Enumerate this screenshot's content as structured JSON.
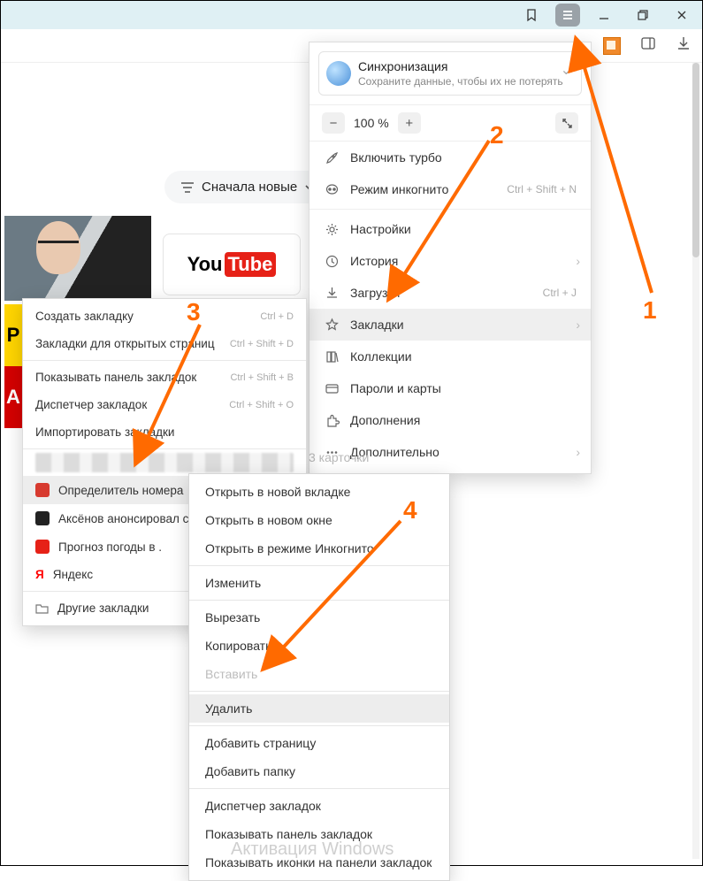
{
  "titlebar": {
    "bookmark_icon": "bookmark",
    "menu_icon": "menu"
  },
  "toolbar": {
    "ext_icon": "extension",
    "sidebar_icon": "sidebar",
    "download_icon": "download"
  },
  "sort_pill": {
    "label": "Сначала новые"
  },
  "sync": {
    "title": "Синхронизация",
    "subtitle": "Сохраните данные, чтобы их не потерять"
  },
  "zoom": {
    "minus": "−",
    "value": "100 %",
    "plus": "+"
  },
  "main_menu": [
    {
      "icon": "rocket",
      "label": "Включить турбо",
      "shortcut": "",
      "arrow": false,
      "highlight": false
    },
    {
      "icon": "mask",
      "label": "Режим инкогнито",
      "shortcut": "Ctrl + Shift + N",
      "arrow": false,
      "highlight": false
    },
    {
      "sep": true
    },
    {
      "icon": "gear",
      "label": "Настройки",
      "shortcut": "",
      "arrow": false
    },
    {
      "icon": "clock",
      "label": "История",
      "shortcut": "",
      "arrow": true
    },
    {
      "icon": "download",
      "label": "Загрузки",
      "shortcut": "Ctrl + J",
      "arrow": false
    },
    {
      "icon": "star",
      "label": "Закладки",
      "shortcut": "",
      "arrow": true,
      "highlight": true
    },
    {
      "icon": "collection",
      "label": "Коллекции",
      "shortcut": "",
      "arrow": false
    },
    {
      "icon": "card",
      "label": "Пароли и карты",
      "shortcut": "",
      "arrow": false
    },
    {
      "icon": "puzzle",
      "label": "Дополнения",
      "shortcut": "",
      "arrow": false
    },
    {
      "icon": "dots",
      "label": "Дополнительно",
      "shortcut": "",
      "arrow": true
    }
  ],
  "cards_label": "3 карточки",
  "bookmarks_menu": {
    "top": [
      {
        "label": "Создать закладку",
        "shortcut": "Ctrl + D"
      },
      {
        "label": "Закладки для открытых страниц",
        "shortcut": "Ctrl + Shift + D"
      }
    ],
    "mid": [
      {
        "label": "Показывать панель закладок",
        "shortcut": "Ctrl + Shift + B"
      },
      {
        "label": "Диспетчер закладок",
        "shortcut": "Ctrl + Shift + O"
      },
      {
        "label": "Импортировать закладки"
      }
    ],
    "items": [
      {
        "icon_color": "#d73a2f",
        "label": "Определитель номера",
        "hover": true
      },
      {
        "icon_color": "#222",
        "label": "Аксёнов анонсировал с"
      },
      {
        "icon_color": "#e62117",
        "label": "Прогноз погоды в ."
      },
      {
        "icon_color": "#ff0000",
        "label": "Яндекс",
        "icon_text": "Я"
      }
    ],
    "other": {
      "label": "Другие закладки"
    }
  },
  "context_menu": [
    {
      "label": "Открыть в новой вкладке"
    },
    {
      "label": "Открыть в новом окне"
    },
    {
      "label": "Открыть в режиме Инкогнито"
    },
    {
      "sep": true
    },
    {
      "label": "Изменить"
    },
    {
      "sep": true
    },
    {
      "label": "Вырезать"
    },
    {
      "label": "Копировать"
    },
    {
      "label": "Вставить",
      "disabled": true
    },
    {
      "sep": true
    },
    {
      "label": "Удалить",
      "hover": true
    },
    {
      "sep": true
    },
    {
      "label": "Добавить страницу"
    },
    {
      "label": "Добавить папку"
    },
    {
      "sep": true
    },
    {
      "label": "Диспетчер закладок"
    },
    {
      "label": "Показывать панель закладок"
    },
    {
      "label": "Показывать иконки на панели закладок"
    }
  ],
  "anno": {
    "n1": "1",
    "n2": "2",
    "n3": "3",
    "n4": "4"
  },
  "watermark": "Активация Windows"
}
